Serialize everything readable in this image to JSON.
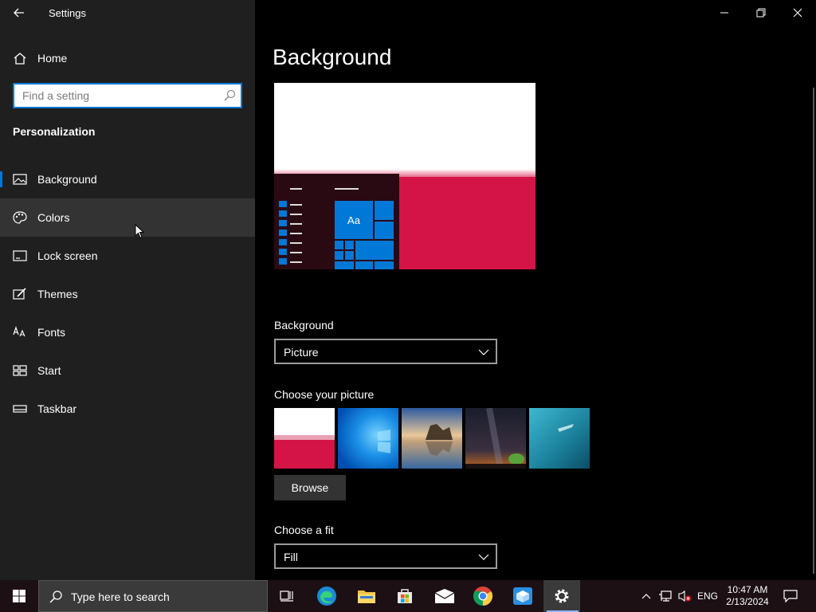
{
  "app": {
    "title": "Settings"
  },
  "sidebar": {
    "home_label": "Home",
    "search_placeholder": "Find a setting",
    "section_title": "Personalization",
    "items": [
      {
        "label": "Background",
        "icon": "picture-icon",
        "selected": true
      },
      {
        "label": "Colors",
        "icon": "palette-icon",
        "hover": true
      },
      {
        "label": "Lock screen",
        "icon": "lock-screen-icon"
      },
      {
        "label": "Themes",
        "icon": "brush-icon"
      },
      {
        "label": "Fonts",
        "icon": "font-icon"
      },
      {
        "label": "Start",
        "icon": "start-icon"
      },
      {
        "label": "Taskbar",
        "icon": "taskbar-icon"
      }
    ]
  },
  "main": {
    "title": "Background",
    "preview": {
      "tile_text": "Aa"
    },
    "background_label": "Background",
    "background_value": "Picture",
    "choose_picture_label": "Choose your picture",
    "browse_label": "Browse",
    "fit_label": "Choose a fit",
    "fit_value": "Fill"
  },
  "taskbar": {
    "search_placeholder": "Type here to search",
    "language": "ENG",
    "time": "10:47 AM",
    "date": "2/13/2024"
  },
  "colors": {
    "accent": "#0078d7",
    "preview_red": "#d41447",
    "sidebar_bg": "#1f1f1f",
    "main_bg": "#000000"
  }
}
